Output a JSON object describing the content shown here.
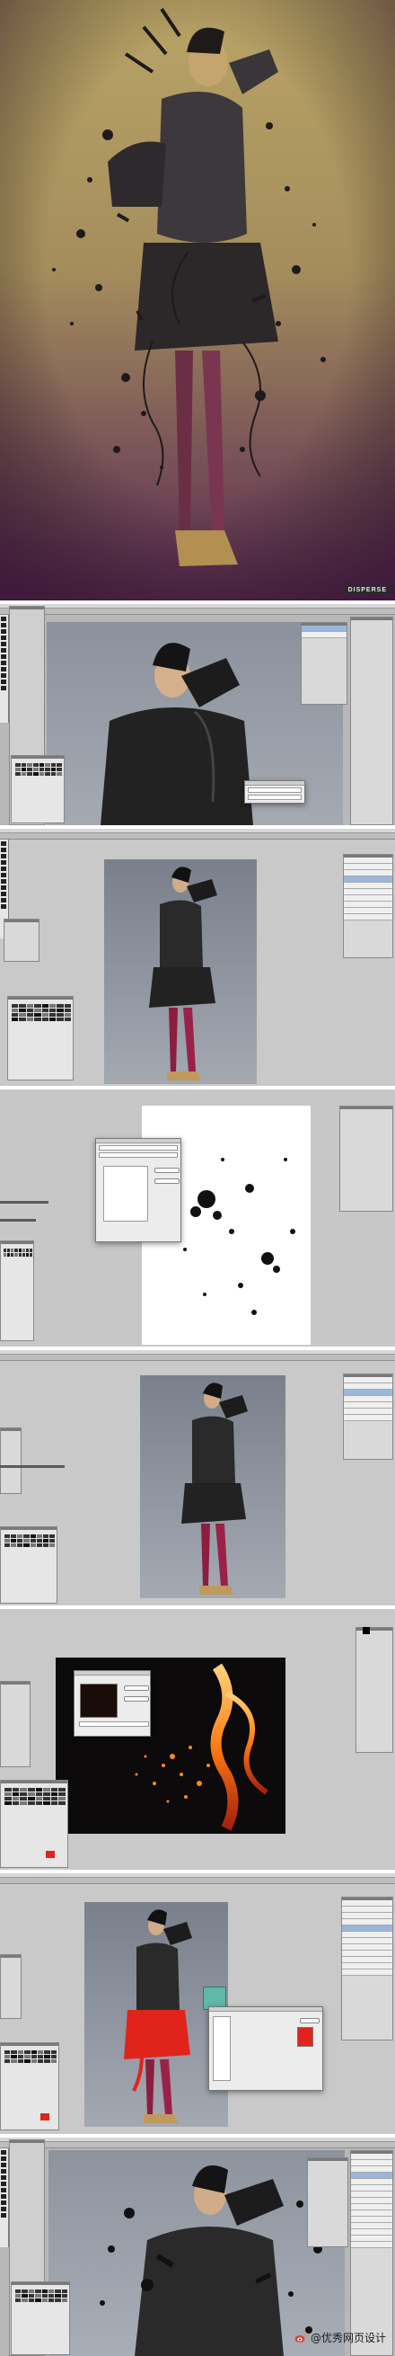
{
  "hero": {
    "signature": "DISPERSE",
    "tint_top": "#b39f63",
    "tint_bottom": "#5a2b52"
  },
  "steps": [
    {
      "name": "step-1-original-photo"
    },
    {
      "name": "step-2-duplicate-layers"
    },
    {
      "name": "step-3-splatter-brush"
    },
    {
      "name": "step-4-mask-applied"
    },
    {
      "name": "step-5-fire-texture"
    },
    {
      "name": "step-6-color-overlay"
    },
    {
      "name": "step-7-final-compose"
    }
  ],
  "colors": {
    "ui_grey": "#c7c7c7",
    "stocking_red": "#7a1834",
    "highlight_red": "#e0241c",
    "fire_orange": "#ff8a1a",
    "dialog_teal": "#5fb8a8"
  },
  "watermark": {
    "text": "@优秀网页设计",
    "icon": "weibo-icon"
  }
}
